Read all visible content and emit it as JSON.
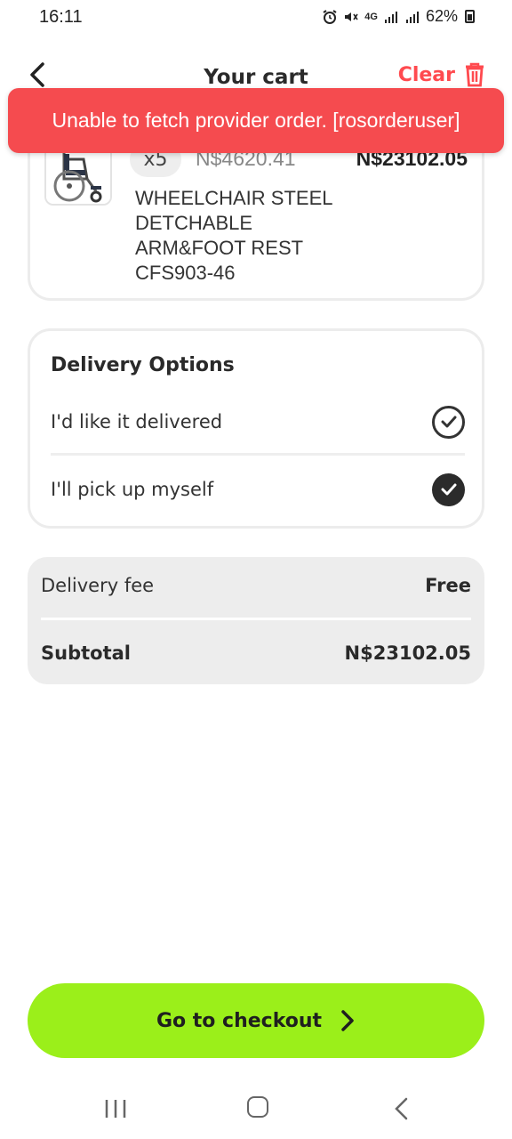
{
  "status_bar": {
    "time": "16:11",
    "network": "4G",
    "battery": "62%"
  },
  "header": {
    "title": "Your cart",
    "clear_label": "Clear"
  },
  "toast": {
    "message": "Unable to fetch provider order. [rosorderuser]"
  },
  "cart_item": {
    "quantity": "x5",
    "unit_price": "N$4620.41",
    "line_total": "N$23102.05",
    "name": "WHEELCHAIR STEEL DETCHABLE ARM&FOOT REST CFS903-46"
  },
  "delivery_options": {
    "title": "Delivery Options",
    "options": [
      {
        "label": "I'd like it delivered",
        "selected": false
      },
      {
        "label": "I'll pick up myself",
        "selected": true
      }
    ]
  },
  "summary": {
    "delivery_fee_label": "Delivery fee",
    "delivery_fee_value": "Free",
    "subtotal_label": "Subtotal",
    "subtotal_value": "N$23102.05"
  },
  "checkout": {
    "label": "Go to checkout"
  },
  "colors": {
    "accent_red": "#f54b4f",
    "checkout_green": "#9bef1a"
  }
}
